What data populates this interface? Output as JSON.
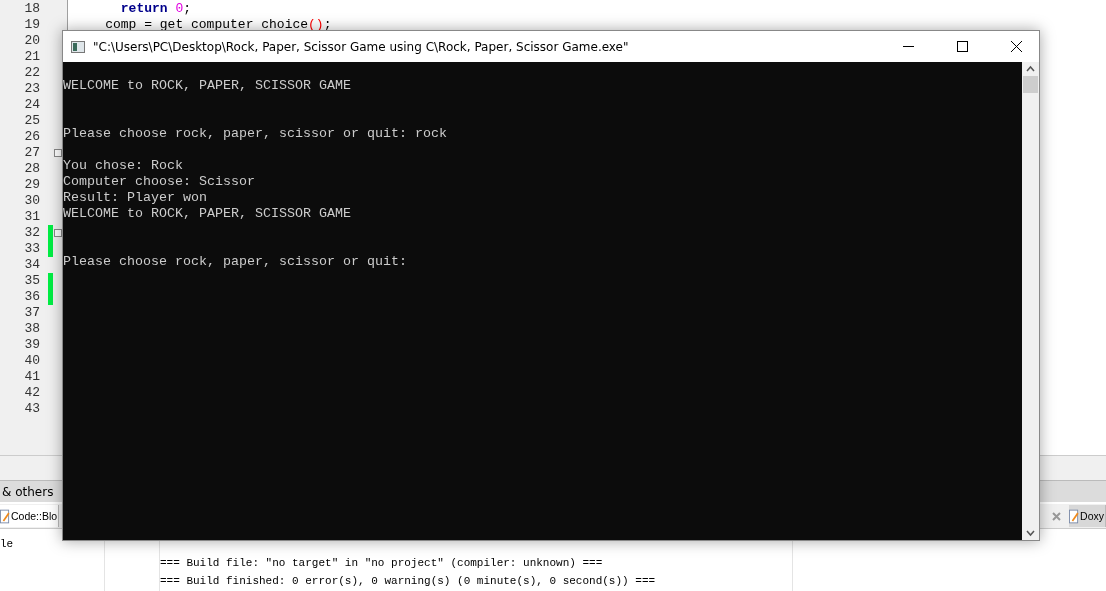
{
  "editor": {
    "lines": [
      {
        "number": "18",
        "changed": false,
        "fold": false,
        "tokens": [
          {
            "text": "      return ",
            "kind": "keyword"
          },
          {
            "text": "0",
            "kind": "number"
          },
          {
            "text": ";",
            "kind": "plain"
          }
        ]
      },
      {
        "number": "19",
        "changed": false,
        "fold": false,
        "tokens": [
          {
            "text": "    comp = get computer choice",
            "kind": "plain"
          },
          {
            "text": "()",
            "kind": "brace"
          },
          {
            "text": ";",
            "kind": "plain"
          }
        ]
      },
      {
        "number": "20",
        "changed": false,
        "fold": false
      },
      {
        "number": "21",
        "changed": false,
        "fold": false
      },
      {
        "number": "22",
        "changed": false,
        "fold": false
      },
      {
        "number": "23",
        "changed": false,
        "fold": false
      },
      {
        "number": "24",
        "changed": false,
        "fold": false
      },
      {
        "number": "25",
        "changed": false,
        "fold": false
      },
      {
        "number": "26",
        "changed": false,
        "fold": false
      },
      {
        "number": "27",
        "changed": false,
        "fold": true
      },
      {
        "number": "28",
        "changed": false,
        "fold": false
      },
      {
        "number": "29",
        "changed": false,
        "fold": false
      },
      {
        "number": "30",
        "changed": false,
        "fold": false
      },
      {
        "number": "31",
        "changed": false,
        "fold": false
      },
      {
        "number": "32",
        "changed": true,
        "fold": true
      },
      {
        "number": "33",
        "changed": true,
        "fold": false
      },
      {
        "number": "34",
        "changed": false,
        "fold": false
      },
      {
        "number": "35",
        "changed": true,
        "fold": false
      },
      {
        "number": "36",
        "changed": true,
        "fold": false
      },
      {
        "number": "37",
        "changed": false,
        "fold": false
      },
      {
        "number": "38",
        "changed": false,
        "fold": false
      },
      {
        "number": "39",
        "changed": false,
        "fold": false
      },
      {
        "number": "40",
        "changed": false,
        "fold": false
      },
      {
        "number": "41",
        "changed": false,
        "fold": false
      },
      {
        "number": "42",
        "changed": false,
        "fold": false
      },
      {
        "number": "43",
        "changed": false,
        "fold": false
      }
    ]
  },
  "panel_title": "& others",
  "panel_tabs": [
    {
      "label": "Code::Blo",
      "selected": true
    },
    {
      "label": "Doxy",
      "selected": false
    }
  ],
  "log": {
    "column_1_cell": "le",
    "messages": [
      "=== Build file: \"no target\" in \"no project\" (compiler: unknown) ===",
      "=== Build finished: 0 error(s), 0 warning(s) (0 minute(s), 0 second(s)) ==="
    ]
  },
  "console": {
    "title": "\"C:\\Users\\PC\\Desktop\\Rock, Paper, Scissor Game using C\\Rock, Paper, Scissor Game.exe\"",
    "lines": [
      {
        "text": "WELCOME to ROCK, PAPER, SCISSOR GAME",
        "kind": "banner"
      },
      {
        "text": "Please choose rock, paper, scissor or quit: rock",
        "kind": "prompt"
      },
      {
        "text": "You chose: Rock",
        "kind": "output"
      },
      {
        "text": "Computer choose: Scissor",
        "kind": "output"
      },
      {
        "text": "Result: Player won",
        "kind": "output"
      },
      {
        "text": "WELCOME to ROCK, PAPER, SCISSOR GAME",
        "kind": "banner"
      },
      {
        "text": "Please choose rock, paper, scissor or quit:",
        "kind": "prompt"
      }
    ]
  }
}
